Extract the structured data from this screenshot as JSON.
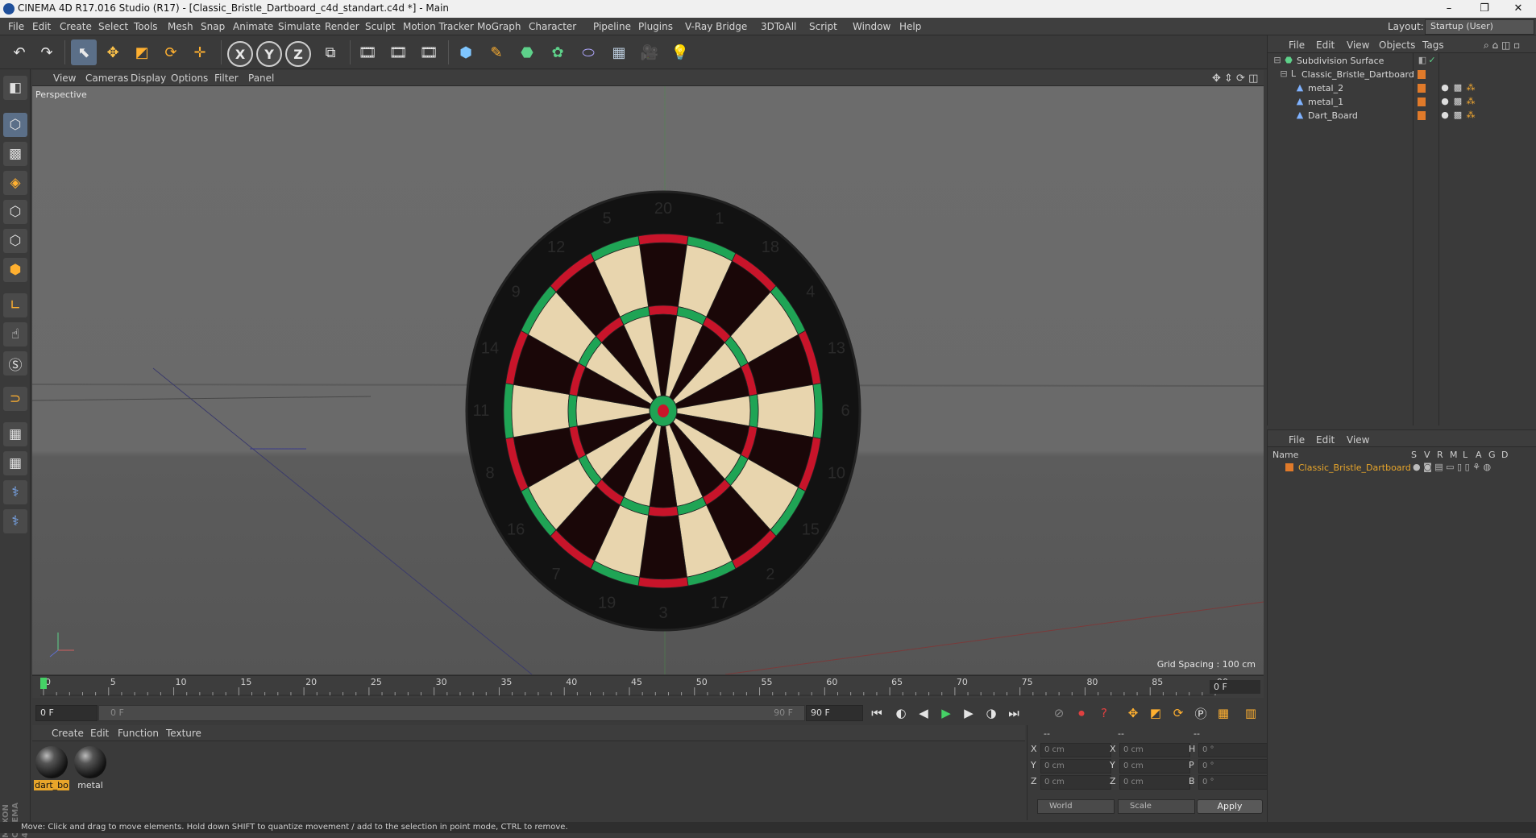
{
  "window": {
    "title": "CINEMA 4D R17.016 Studio (R17) - [Classic_Bristle_Dartboard_c4d_standart.c4d *] - Main",
    "controls": [
      "–",
      "❐",
      "✕"
    ]
  },
  "menubar": {
    "items": [
      "File",
      "Edit",
      "Create",
      "Select",
      "Tools",
      "Mesh",
      "Snap",
      "Animate",
      "Simulate",
      "Render",
      "Sculpt",
      "Motion Tracker",
      "MoGraph",
      "Character",
      "Pipeline",
      "Plugins",
      "V-Ray Bridge",
      "3DToAll",
      "Script",
      "Window",
      "Help"
    ],
    "layout_label": "Layout:",
    "layout_value": "Startup (User)"
  },
  "toolbar": {
    "axis_x": "X",
    "axis_y": "Y",
    "axis_z": "Z"
  },
  "viewport": {
    "menu": [
      "View",
      "Cameras",
      "Display",
      "Options",
      "Filter",
      "Panel"
    ],
    "label": "Perspective",
    "grid_spacing": "Grid Spacing : 100 cm"
  },
  "dartboard": {
    "numbers": [
      "20",
      "1",
      "18",
      "4",
      "13",
      "6",
      "10",
      "15",
      "2",
      "17",
      "3",
      "19",
      "7",
      "16",
      "8",
      "11",
      "14",
      "9",
      "12",
      "5"
    ]
  },
  "timeline": {
    "ticks": [
      "0",
      "5",
      "10",
      "15",
      "20",
      "25",
      "30",
      "35",
      "40",
      "45",
      "50",
      "55",
      "60",
      "65",
      "70",
      "75",
      "80",
      "85",
      "90"
    ],
    "frame": "0 F"
  },
  "transport": {
    "start": "0 F",
    "range_start": "0 F",
    "range_end": "90 F",
    "end": "90 F"
  },
  "materials": {
    "menu": [
      "Create",
      "Edit",
      "Function",
      "Texture"
    ],
    "items": [
      {
        "label": "dart_bo"
      },
      {
        "label": "metal"
      }
    ]
  },
  "coordinates": {
    "header": [
      "--",
      "--",
      "--"
    ],
    "rows": [
      {
        "pos_label": "X",
        "pos": "0 cm",
        "size_label": "X",
        "size": "0 cm",
        "rot_label": "H",
        "rot": "0 °"
      },
      {
        "pos_label": "Y",
        "pos": "0 cm",
        "size_label": "Y",
        "size": "0 cm",
        "rot_label": "P",
        "rot": "0 °"
      },
      {
        "pos_label": "Z",
        "pos": "0 cm",
        "size_label": "Z",
        "size": "0 cm",
        "rot_label": "B",
        "rot": "0 °"
      }
    ],
    "mode1": "World",
    "mode2": "Scale",
    "apply": "Apply"
  },
  "object_manager": {
    "menu": [
      "File",
      "Edit",
      "View",
      "Objects",
      "Tags"
    ],
    "objects": [
      {
        "name": "Subdivision Surface"
      },
      {
        "name": "Classic_Bristle_Dartboard"
      },
      {
        "name": "metal_2"
      },
      {
        "name": "metal_1"
      },
      {
        "name": "Dart_Board"
      }
    ]
  },
  "layer_manager": {
    "menu": [
      "File",
      "Edit",
      "View"
    ],
    "name_header": "Name",
    "cols": [
      "S",
      "V",
      "R",
      "M",
      "L",
      "A",
      "G",
      "D"
    ],
    "row": "Classic_Bristle_Dartboard"
  },
  "status": {
    "text": "Move: Click and drag to move elements. Hold down SHIFT to quantize movement / add to the selection in point mode, CTRL to remove."
  },
  "logo": "MAXON CINEMA 4D",
  "colors": {
    "accent": "#e8a52a",
    "dart_red": "#c8142a",
    "dart_green": "#1fa455",
    "dart_cream": "#e8d5ae",
    "dart_black": "#1a0708"
  }
}
